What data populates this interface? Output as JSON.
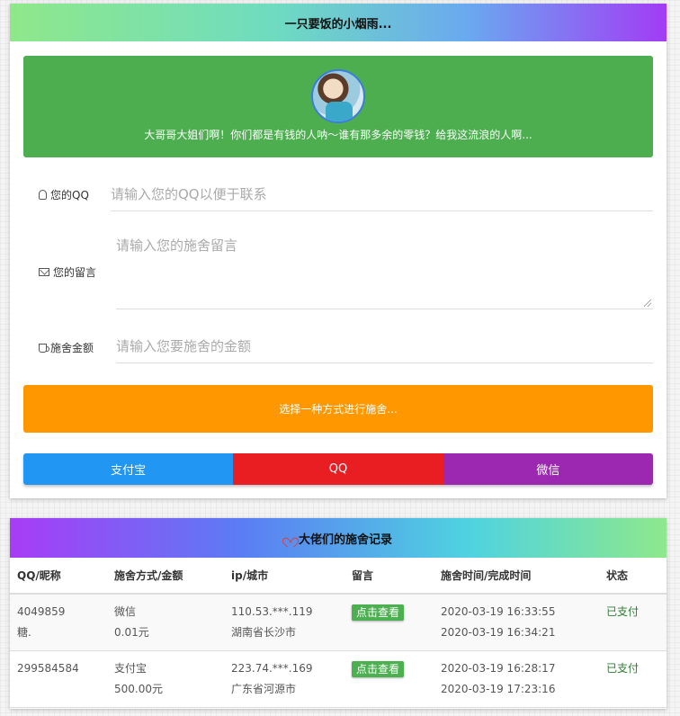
{
  "donate_panel": {
    "title": "一只要饭的小烟雨...",
    "banner_text": "大哥哥大姐们啊！你们都是有钱的人呐～谁有那多余的零钱？给我这流浪的人啊...",
    "qq_field": {
      "label": "您的QQ",
      "placeholder": "请输入您的QQ以便于联系",
      "icon": "qq-icon"
    },
    "message_field": {
      "label": "您的留言",
      "placeholder": "请输入您的施舍留言",
      "icon": "envelope-icon"
    },
    "amount_field": {
      "label": "施舍金额",
      "placeholder": "请输入您要施舍的金额",
      "icon": "coffee-cup-icon"
    },
    "choose_button": "选择一种方式进行施舍...",
    "pay_methods": [
      {
        "label": "支付宝",
        "color": "#2196f3"
      },
      {
        "label": "QQ",
        "color": "#e91e23"
      },
      {
        "label": "微信",
        "color": "#9c27b0"
      }
    ],
    "banner_color": "#4cae4f",
    "choose_color": "#ff9800"
  },
  "records_panel": {
    "title": "大佬们的施舍记录",
    "title_icon": "heart-icon",
    "columns": [
      "QQ/昵称",
      "施舍方式/金额",
      "ip/城市",
      "留言",
      "施舍时间/完成时间",
      "状态"
    ],
    "rows": [
      {
        "qq": "4049859",
        "nickname": "糖.",
        "method": "微信",
        "amount": "0.01元",
        "ip": "110.53.***.119",
        "city": "湖南省长沙市",
        "message_button": "点击查看",
        "start_time": "2020-03-19 16:33:55",
        "finish_time": "2020-03-19 16:34:21",
        "status": "已支付"
      },
      {
        "qq": "299584584",
        "nickname": "",
        "method": "支付宝",
        "amount": "500.00元",
        "ip": "223.74.***.169",
        "city": "广东省河源市",
        "message_button": "点击查看",
        "start_time": "2020-03-19 16:28:17",
        "finish_time": "2020-03-19 17:23:16",
        "status": "已支付"
      }
    ]
  }
}
